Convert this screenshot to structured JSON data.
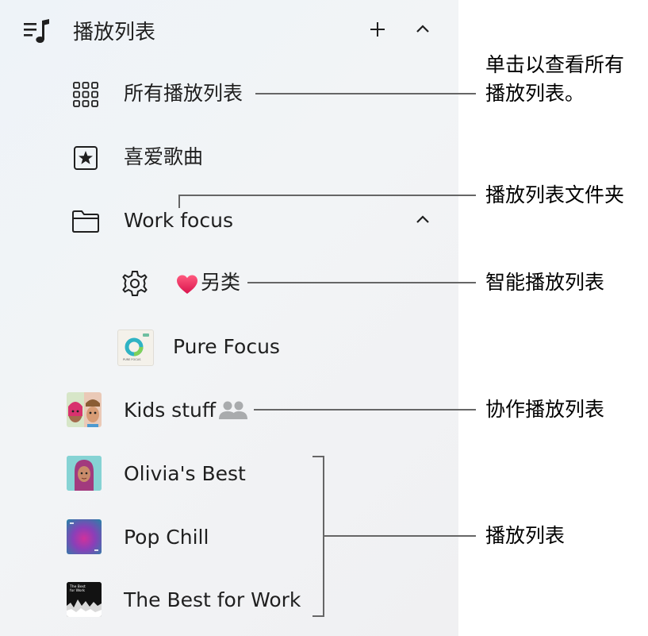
{
  "sidebar": {
    "header": {
      "icon": "music-list-icon",
      "title": "播放列表",
      "add_icon": "plus-icon",
      "collapse_icon": "chevron-up-icon"
    },
    "items": [
      {
        "label": "所有播放列表",
        "icon": "grid-icon"
      },
      {
        "label": "喜爱歌曲",
        "icon": "star-box-icon"
      },
      {
        "label": "Work focus",
        "icon": "folder-icon",
        "chevron": "chevron-up-icon"
      },
      {
        "label": "另类",
        "icon": "gear-icon",
        "emoji": "heart"
      },
      {
        "label": "Pure Focus",
        "thumbnail": "pure-focus-art"
      },
      {
        "label": "Kids stuff",
        "thumbnail": "kids-art",
        "badge_icon": "people-icon"
      },
      {
        "label": "Olivia's Best",
        "thumbnail": "olivia-art"
      },
      {
        "label": "Pop Chill",
        "thumbnail": "pop-chill-art"
      },
      {
        "label": "The Best for Work",
        "thumbnail": "best-for-work-art"
      }
    ]
  },
  "callouts": {
    "all_playlists_line1": "单击以查看所有",
    "all_playlists_line2": "播放列表。",
    "folder": "播放列表文件夹",
    "smart": "智能播放列表",
    "collaborative": "协作播放列表",
    "playlists": "播放列表"
  },
  "thumb_text": {
    "pure_focus": "PURE FOCUS",
    "best_for_work": "The Best for Work"
  },
  "colors": {
    "sidebar_bg": "#eff2f6",
    "callout_line": "#666666",
    "heart": "#e8265e",
    "people_icon": "#a9abad"
  }
}
